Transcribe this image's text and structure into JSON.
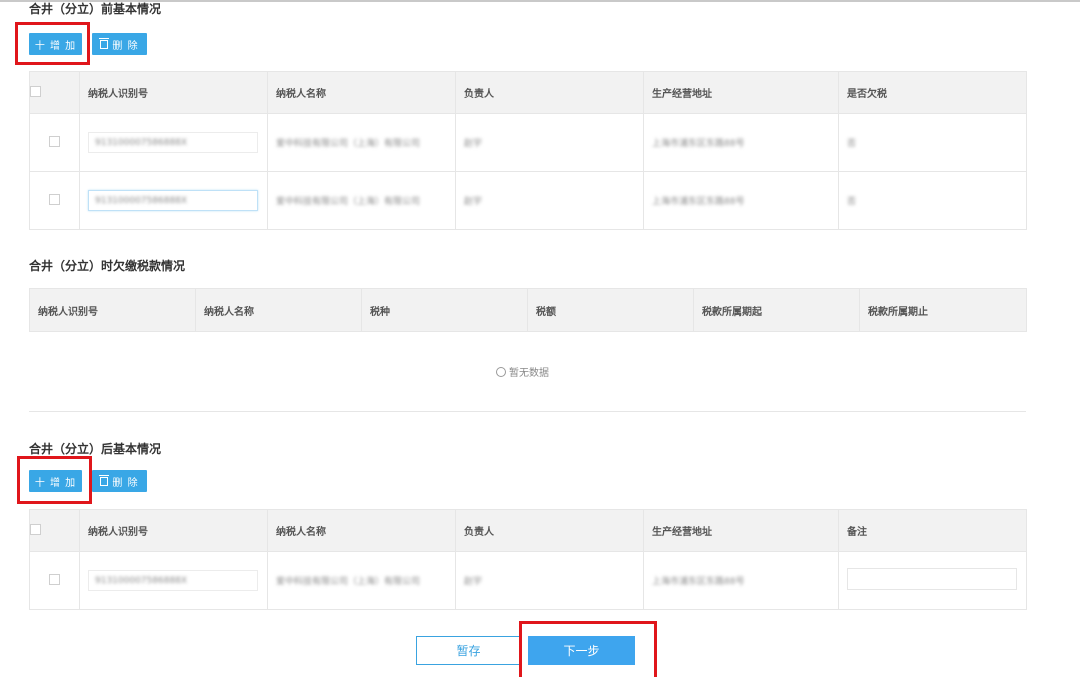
{
  "section_before": {
    "title": "合井（分立）前基本情况",
    "add_label": "十 增 加",
    "delete_label": "删 除",
    "columns": [
      "纳税人识别号",
      "纳税人名称",
      "负责人",
      "生产经营地址",
      "是否欠税"
    ],
    "rows": [
      {
        "id": "913100007586888X",
        "name": "爱中科技有限公司（上海）有限公司",
        "person": "赵宇",
        "address": "上海市浦东区东路88号",
        "value": "否"
      },
      {
        "id": "913100007586888X",
        "name": "爱中科技有限公司（上海）有限公司",
        "person": "赵宇",
        "address": "上海市浦东区东路88号",
        "value": "否"
      }
    ]
  },
  "section_arrears": {
    "title": "合井（分立）时欠缴税款情况",
    "columns": [
      "纳税人识别号",
      "纳税人名称",
      "税种",
      "税额",
      "税款所属期起",
      "税款所属期止"
    ],
    "empty_text": "暂无数据"
  },
  "section_after": {
    "title": "合井（分立）后基本情况",
    "add_label": "十 增 加",
    "delete_label": "删 除",
    "columns": [
      "纳税人识别号",
      "纳税人名称",
      "负责人",
      "生产经营地址",
      "备注"
    ],
    "rows": [
      {
        "id": "913100007586888X",
        "name": "爱中科技有限公司（上海）有限公司",
        "person": "赵宇",
        "address": "上海市浦东区东路88号",
        "value": ""
      }
    ]
  },
  "footer": {
    "save_label": "暂存",
    "next_label": "下一步"
  },
  "colors": {
    "accent": "#39a7e6",
    "highlight": "#e0161b",
    "header_bg": "#f2f2f2"
  }
}
